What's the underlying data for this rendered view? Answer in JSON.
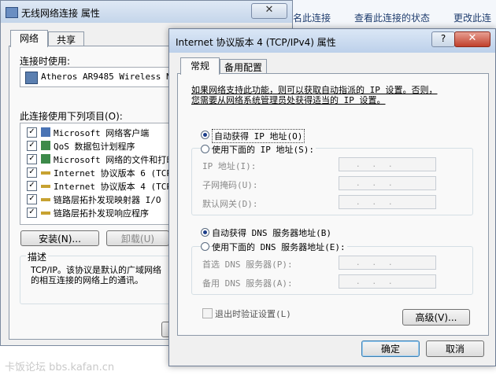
{
  "background": {
    "links": [
      "名此连接",
      "查看此连接的状态",
      "更改此连"
    ]
  },
  "win1": {
    "title": "无线网络连接 属性",
    "close_glyph": "✕",
    "tabs": [
      "网络",
      "共享"
    ],
    "connect_using_label": "连接时使用:",
    "adapter": "Atheros AR9485 Wireless Ne",
    "items_label": "此连接使用下列项目(O):",
    "items": [
      "Microsoft 网络客户端",
      "QoS 数据包计划程序",
      "Microsoft 网络的文件和打印",
      "Internet 协议版本 6 (TCP/",
      "Internet 协议版本 4 (TCP/",
      "链路层拓扑发现映射器 I/O",
      "链路层拓扑发现响应程序"
    ],
    "check_mark": "✓",
    "install_button": "安装(N)...",
    "uninstall_button": "卸载(U)",
    "desc_label": "描述",
    "desc_text_1": "TCP/IP。该协议是默认的广域网络",
    "desc_text_2": "的相互连接的网络上的通讯。"
  },
  "win2": {
    "title": "Internet 协议版本 4 (TCP/IPv4) 属性",
    "help_glyph": "?",
    "close_glyph": "✕",
    "tabs": [
      "常规",
      "备用配置"
    ],
    "intro_1": "如果网络支持此功能，则可以获取自动指派的 IP 设置。否则，",
    "intro_2": "您需要从网络系统管理员处获得适当的 IP 设置。",
    "auto_ip": "自动获得 IP 地址(O)",
    "manual_ip": "使用下面的 IP 地址(S):",
    "ip_address": "IP 地址(I):",
    "subnet_mask": "子网掩码(U):",
    "gateway": "默认网关(D):",
    "auto_dns": "自动获得 DNS 服务器地址(B)",
    "manual_dns": "使用下面的 DNS 服务器地址(E):",
    "preferred_dns": "首选 DNS 服务器(P):",
    "alternate_dns": "备用 DNS 服务器(A):",
    "ip_dots": "...",
    "validate_on_exit": "退出时验证设置(L)",
    "advanced_button": "高级(V)...",
    "ok_button": "确定",
    "cancel_button": "取消"
  },
  "watermark": "卡饭论坛 bbs.kafan.cn"
}
